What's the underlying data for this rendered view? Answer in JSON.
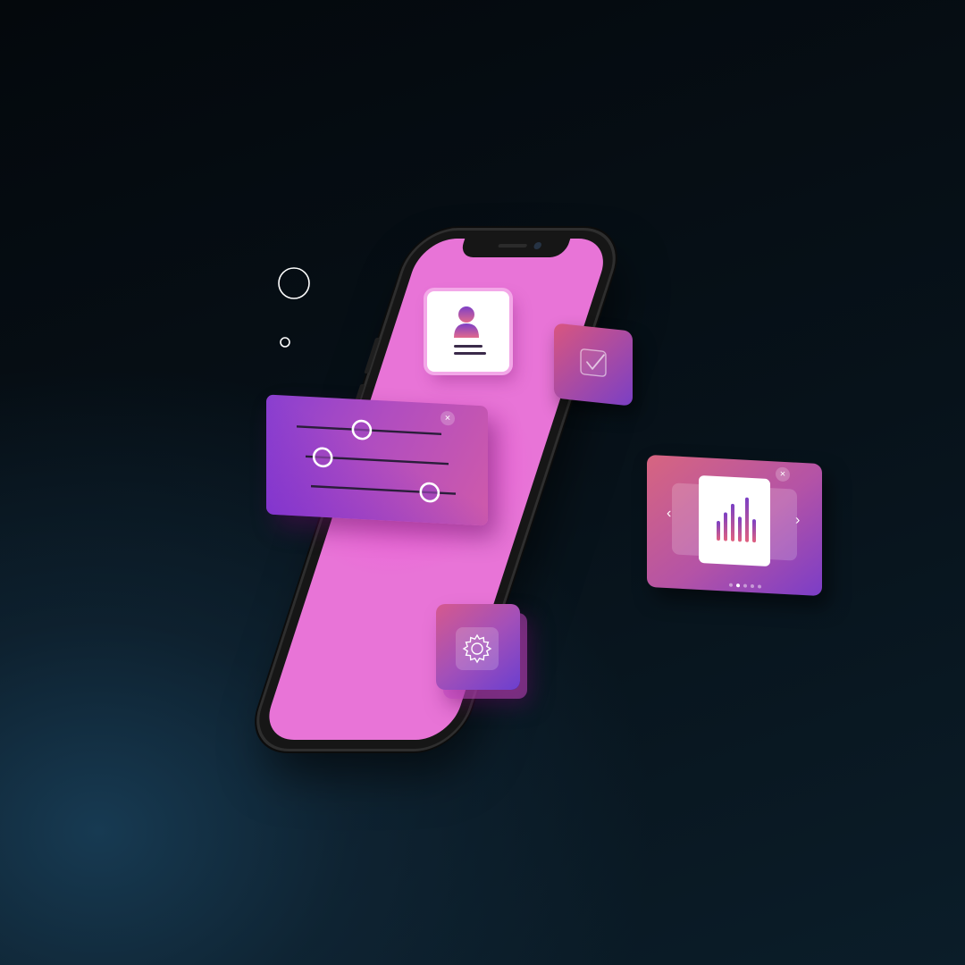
{
  "scene": {
    "background_top": "#04080c",
    "background_glow": "#173a52"
  },
  "phone": {
    "body_color": "#161616",
    "screen_color": "#e874d7"
  },
  "accent": {
    "magenta": "#e874d7",
    "purple": "#7a3fc5",
    "coral": "#d9567f"
  },
  "icons": {
    "profile": "user-icon",
    "check": "checkbox-check-icon",
    "gear": "gear-icon",
    "chart": "bar-chart-icon",
    "close": "close-icon",
    "prev": "chevron-left-icon",
    "next": "chevron-right-icon"
  },
  "sliders": {
    "levels": [
      0.45,
      0.12,
      0.82
    ]
  },
  "chart_carousel": {
    "page_count": 5,
    "active_page": 2,
    "close_glyph": "×",
    "prev_glyph": "‹",
    "next_glyph": "›"
  },
  "slider_panel": {
    "close_glyph": "×"
  }
}
